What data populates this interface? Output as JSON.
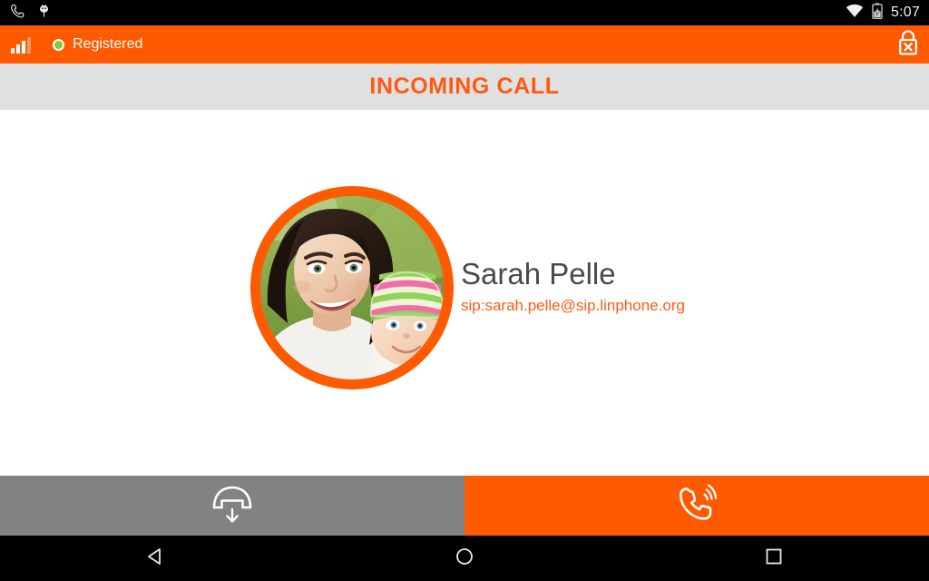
{
  "status_bar": {
    "icons": [
      "phone-icon",
      "bug-droid-icon",
      "wifi-icon",
      "battery-charging-icon"
    ],
    "time": "5:07"
  },
  "app_bar": {
    "signal_icon": "signal-bars-icon",
    "signal_bars_filled": 3,
    "signal_bars_total": 4,
    "registration_status": "Registered",
    "registration_color": "#8bc832",
    "encryption_icon": "lock-crossed-icon",
    "background_color": "#ff5a00"
  },
  "header": {
    "call_state": "INCOMING CALL",
    "background_color": "#e0e0e0",
    "text_color": "#ff5a14"
  },
  "contact": {
    "name": "Sarah Pelle",
    "sip_address": "sip:sarah.pelle@sip.linphone.org",
    "avatar_icon": "contact-photo",
    "avatar_ring_color": "#ff5a00",
    "name_color": "#4a4a4a",
    "sip_color": "#ff5a14"
  },
  "actions": {
    "decline": {
      "icon": "hang-up-icon",
      "background_color": "#828282"
    },
    "answer": {
      "icon": "ringing-phone-icon",
      "background_color": "#ff5a00"
    }
  },
  "nav_bar": {
    "back_icon": "back-triangle-icon",
    "home_icon": "home-circle-icon",
    "recents_icon": "recents-square-icon"
  }
}
